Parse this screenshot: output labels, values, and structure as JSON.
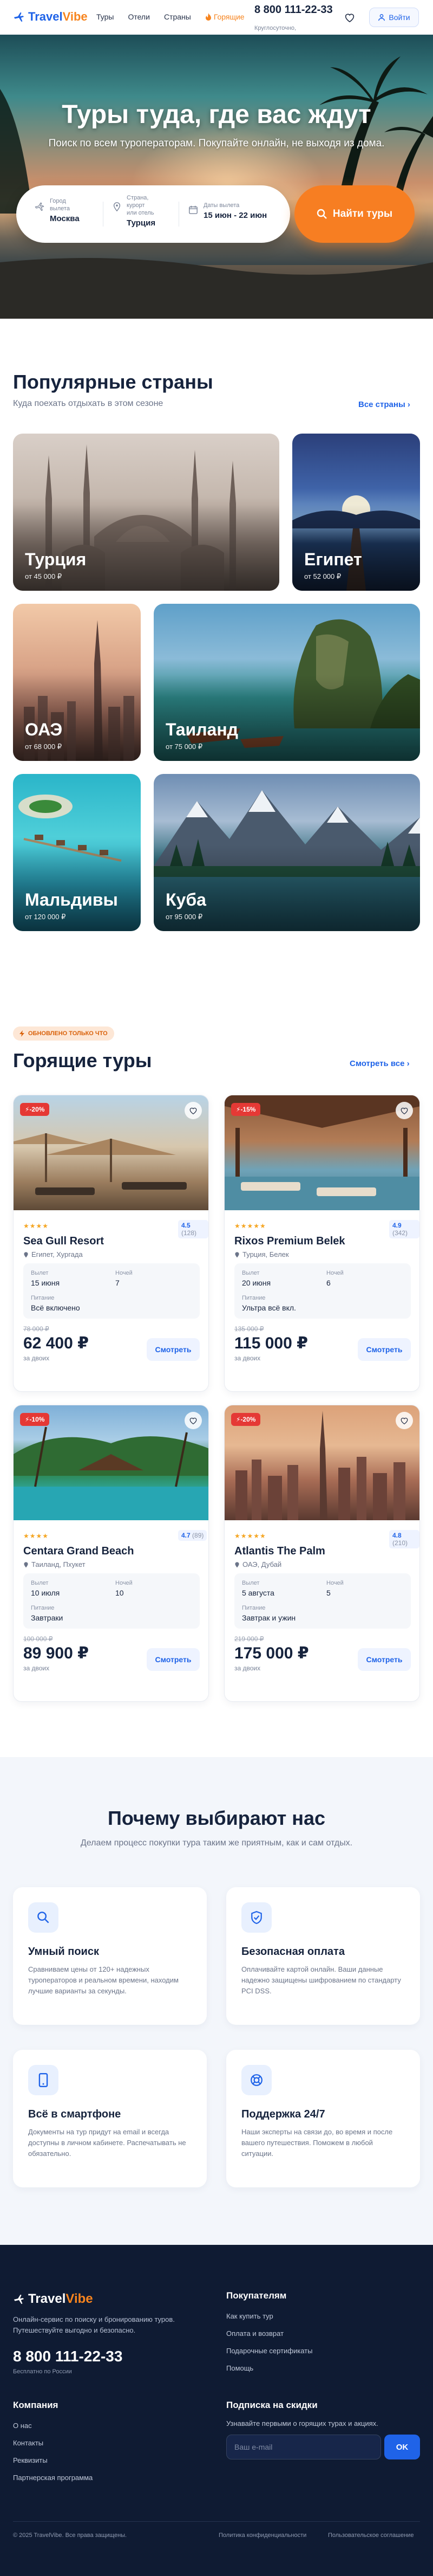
{
  "header": {
    "logo_text": "TravelVibe",
    "logo_brand": "Travel",
    "logo_accent": "Vibe",
    "nav": [
      "Туры",
      "Отели",
      "Страны"
    ],
    "hot_label": "Горящие",
    "phone": "8 800 111-22-33",
    "phone_sub": "Круглосуточно,",
    "login_label": "Войти"
  },
  "hero": {
    "title": "Туры туда, где вас ждут",
    "subtitle": "Поиск по всем туроператорам. Покупайте онлайн, не выходя из дома.",
    "from_label_1": "Город",
    "from_label_2": "вылета",
    "from_value": "Москва",
    "to_label_1": "Страна,",
    "to_label_2": "курорт",
    "to_label_3": "или отель",
    "to_value": "Турция",
    "dates_label": "Даты вылета",
    "dates_value": "15 июн - 22 июн",
    "search_button": "Найти туры"
  },
  "countries": {
    "title": "Популярные страны",
    "subtitle": "Куда поехать отдыхать в этом сезоне",
    "see_all": "Все страны",
    "items": [
      {
        "name": "Турция",
        "price": "от 45 000 ₽"
      },
      {
        "name": "Египет",
        "price": "от 52 000 ₽"
      },
      {
        "name": "ОАЭ",
        "price": "от 68 000 ₽"
      },
      {
        "name": "Таиланд",
        "price": "от 75 000 ₽"
      },
      {
        "name": "Мальдивы",
        "price": "от 120 000 ₽"
      },
      {
        "name": "Куба",
        "price": "от 95 000 ₽"
      }
    ]
  },
  "hot": {
    "badge": "ОБНОВЛЕНО ТОЛЬКО ЧТО",
    "title": "Горящие туры",
    "see_all": "Смотреть все",
    "labels": {
      "departure": "Вылет",
      "nights": "Ночей",
      "food": "Питание",
      "per": "за двоих",
      "view": "Смотреть"
    },
    "tours": [
      {
        "discount": "-20%",
        "stars": "★★★★",
        "rating": "4.5",
        "reviews": "(128)",
        "name": "Sea Gull Resort",
        "location": "Египет, Хургада",
        "departure": "15 июня",
        "nights": "7",
        "food": "Всё включено",
        "old_price": "78 000 ₽",
        "price": "62 400 ₽"
      },
      {
        "discount": "-15%",
        "stars": "★★★★★",
        "rating": "4.9",
        "reviews": "(342)",
        "name": "Rixos Premium Belek",
        "location": "Турция, Белек",
        "departure": "20 июня",
        "nights": "6",
        "food": "Ультра всё вкл.",
        "old_price": "135 000 ₽",
        "price": "115 000 ₽"
      },
      {
        "discount": "-10%",
        "stars": "★★★★",
        "rating": "4.7",
        "reviews": "(89)",
        "name": "Centara Grand Beach",
        "location": "Таиланд, Пхукет",
        "departure": "10 июля",
        "nights": "10",
        "food": "Завтраки",
        "old_price": "100 000 ₽",
        "price": "89 900 ₽"
      },
      {
        "discount": "-20%",
        "stars": "★★★★★",
        "rating": "4.8",
        "reviews": "(210)",
        "name": "Atlantis The Palm",
        "location": "ОАЭ, Дубай",
        "departure": "5 августа",
        "nights": "5",
        "food": "Завтрак и ужин",
        "old_price": "219 000 ₽",
        "price": "175 000 ₽"
      }
    ]
  },
  "why": {
    "title": "Почему выбирают нас",
    "subtitle": "Делаем процесс покупки тура таким же приятным, как и сам отдых.",
    "features": [
      {
        "title": "Умный поиск",
        "desc": "Сравниваем цены от 120+ надежных туроператоров и реальном времени, находим лучшие варианты за секунды."
      },
      {
        "title": "Безопасная оплата",
        "desc": "Оплачивайте картой онлайн. Ваши данные надежно защищены шифрованием по стандарту PCI DSS."
      },
      {
        "title": "Всё в смартфоне",
        "desc": "Документы на тур придут на email и всегда доступны в личном кабинете. Распечатывать не обязательно."
      },
      {
        "title": "Поддержка 24/7",
        "desc": "Наши эксперты на связи до, во время и после вашего путешествия. Поможем в любой ситуации."
      }
    ]
  },
  "footer": {
    "logo_brand": "Travel",
    "logo_accent": "Vibe",
    "desc": "Онлайн-сервис по поиску и бронированию туров. Путешествуйте выгодно и безопасно.",
    "phone": "8 800 111-22-33",
    "phone_note": "Бесплатно по России",
    "buyers_title": "Покупателям",
    "buyers_links": [
      "Как купить тур",
      "Оплата и возврат",
      "Подарочные сертификаты",
      "Помощь"
    ],
    "company_title": "Компания",
    "company_links": [
      "О нас",
      "Контакты",
      "Реквизиты",
      "Партнерская программа"
    ],
    "subscribe_title": "Подписка на скидки",
    "subscribe_text": "Узнавайте первыми о горящих турах и акциях.",
    "email_placeholder": "Ваш e-mail",
    "ok_label": "OK",
    "copyright": "© 2025 TravelVibe. Все права защищены.",
    "privacy": "Политика конфиденциальности",
    "terms": "Пользовательское соглашение"
  }
}
